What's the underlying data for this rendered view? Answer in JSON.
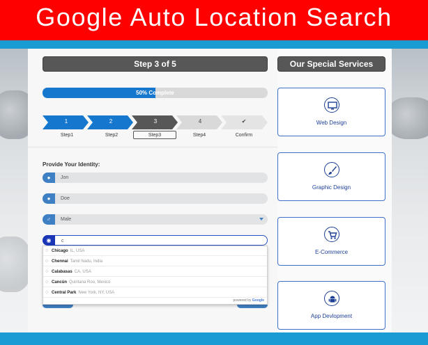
{
  "banner": {
    "title": "Google Auto Location Search"
  },
  "wizard": {
    "header": "Step 3 of 5",
    "progress": {
      "percent": 50,
      "label": "50% Complete"
    },
    "steps": [
      {
        "number": "1",
        "label": "Step1"
      },
      {
        "number": "2",
        "label": "Step2"
      },
      {
        "number": "3",
        "label": "Step3"
      },
      {
        "number": "4",
        "label": "Step4"
      },
      {
        "number": "✔",
        "label": "Confirm"
      }
    ],
    "current_step": 3,
    "identity_label": "Provide Your Identity:",
    "fields": {
      "first_name": "Jon",
      "last_name": "Doe",
      "gender": "Male",
      "location": "c"
    },
    "autocomplete": {
      "suggestions": [
        {
          "main": "Chicago",
          "sub": "IL, USA"
        },
        {
          "main": "Chennai",
          "sub": "Tamil Nadu, India"
        },
        {
          "main": "Calabasas",
          "sub": "CA, USA"
        },
        {
          "main": "Cancún",
          "sub": "Quintana Roo, Mexico"
        },
        {
          "main": "Central Park",
          "sub": "New York, NY, USA"
        }
      ],
      "powered_by": "powered by",
      "powered_brand": "Google"
    }
  },
  "services": {
    "header": "Our Special Services",
    "items": [
      {
        "label": "Web Design",
        "icon": "monitor-icon"
      },
      {
        "label": "Graphic Design",
        "icon": "brush-icon"
      },
      {
        "label": "E-Commerce",
        "icon": "cart-icon"
      },
      {
        "label": "App Devlopment",
        "icon": "android-icon"
      }
    ]
  },
  "colors": {
    "banner": "#ff0000",
    "stripe": "#1a9bd1",
    "progress": "#1677cf",
    "step_done": "#1677cf",
    "step_current": "#575757",
    "step_todo": "#d9d9d9",
    "field_icon": "#3f80c4",
    "service_border": "#3f6fc9"
  }
}
